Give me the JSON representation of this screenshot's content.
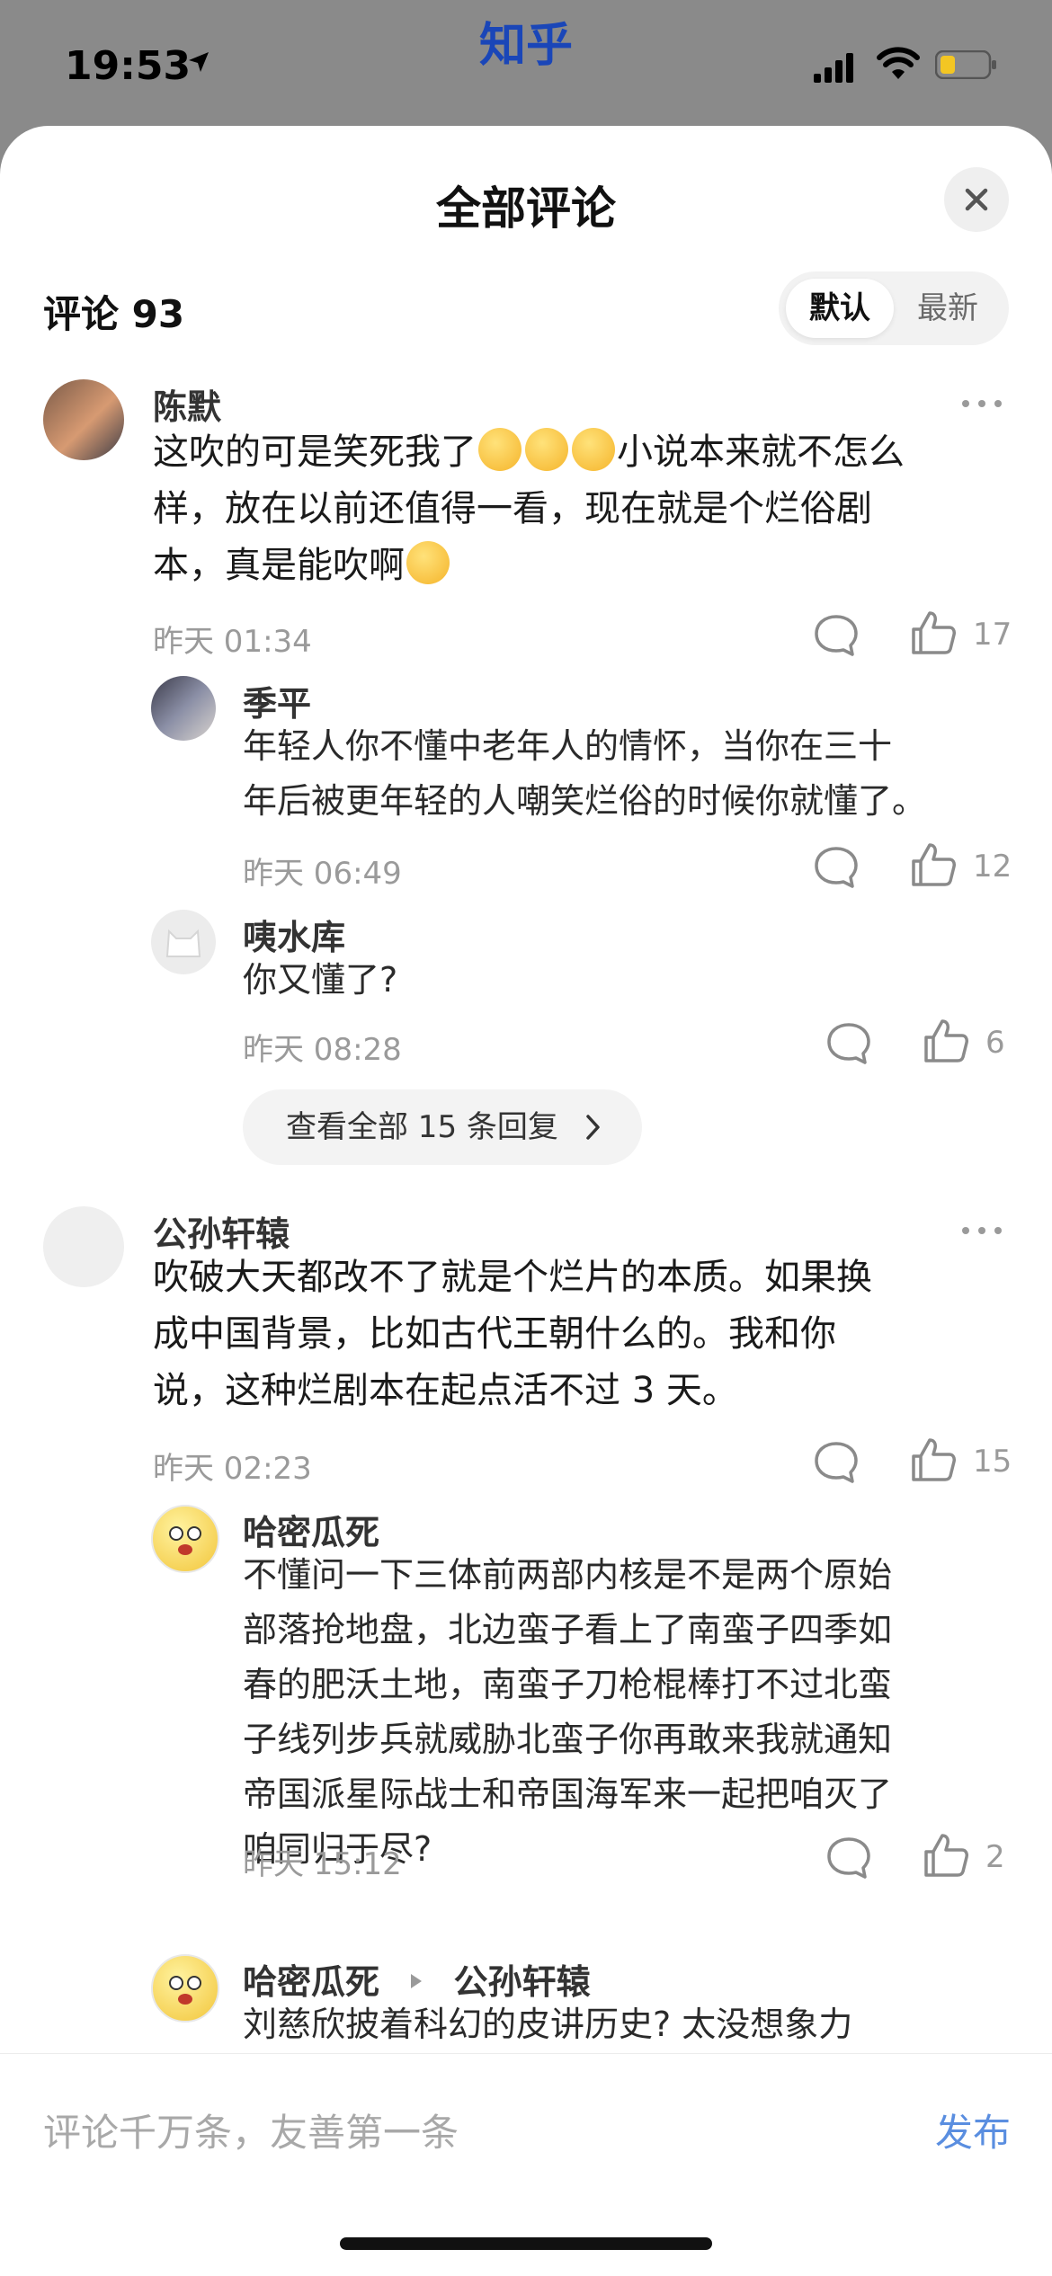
{
  "status": {
    "time": "19:53",
    "app_name": "知乎"
  },
  "sheet": {
    "title": "全部评论",
    "count_label": "评论 93",
    "sort_options": [
      "默认",
      "最新"
    ]
  },
  "comments": [
    {
      "author": "陈默",
      "text_lines": [
        "这吹的可是笑死我了",
        "小说本来就不怎么",
        "样，放在以前还值得一看，现在就是个烂俗剧",
        "本，真是能吹啊"
      ],
      "time": "昨天 01:34",
      "likes": "17",
      "replies": [
        {
          "author": "季平",
          "text_lines": [
            "年轻人你不懂中老年人的情怀，当你在三十",
            "年后被更年轻的人嘲笑烂俗的时候你就懂了。"
          ],
          "time": "昨天 06:49",
          "likes": "12"
        },
        {
          "author": "咦水库",
          "text_lines": [
            "你又懂了?"
          ],
          "time": "昨天 08:28",
          "likes": "6"
        }
      ],
      "view_all": "查看全部 15 条回复"
    },
    {
      "author": "公孙轩辕",
      "text_lines": [
        "吹破大天都改不了就是个烂片的本质。如果换",
        "成中国背景，比如古代王朝什么的。我和你",
        "说，这种烂剧本在起点活不过 3 天。"
      ],
      "time": "昨天 02:23",
      "likes": "15",
      "replies": [
        {
          "author": "哈密瓜死",
          "text_lines": [
            "不懂问一下三体前两部内核是不是两个原始",
            "部落抢地盘，北边蛮子看上了南蛮子四季如",
            "春的肥沃土地，南蛮子刀枪棍棒打不过北蛮",
            "子线列步兵就威胁北蛮子你再敢来我就通知",
            "帝国派星际战士和帝国海军来一起把咱灭了",
            "咱同归于尽?"
          ],
          "time": "昨天 15:12",
          "likes": "2"
        },
        {
          "author": "哈密瓜死",
          "reply_to": "公孙轩辕",
          "text_lines": [
            "刘慈欣披着科幻的皮讲历史? 太没想象力"
          ]
        }
      ]
    }
  ],
  "bottom": {
    "placeholder": "评论千万条，友善第一条",
    "publish": "发布"
  },
  "colors": {
    "accent": "#5a8ee0",
    "app_name": "#1a46b8"
  }
}
